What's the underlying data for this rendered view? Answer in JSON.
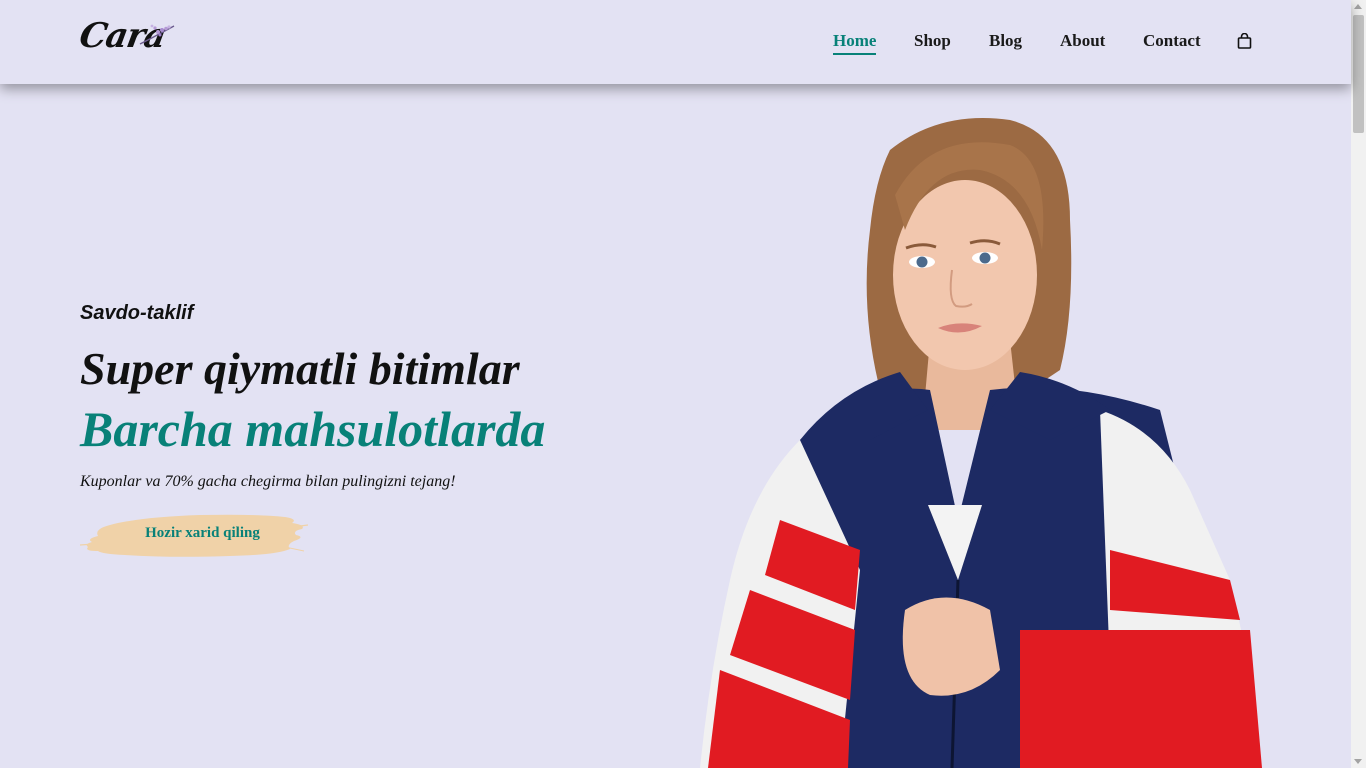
{
  "brand": {
    "logo_text": "Cara"
  },
  "nav": {
    "items": [
      {
        "label": "Home",
        "active": true
      },
      {
        "label": "Shop",
        "active": false
      },
      {
        "label": "Blog",
        "active": false
      },
      {
        "label": "About",
        "active": false
      },
      {
        "label": "Contact",
        "active": false
      }
    ],
    "cart_icon": "shopping-bag-icon"
  },
  "hero": {
    "subtitle": "Savdo-taklif",
    "title": "Super qiymatli bitimlar",
    "highlight": "Barcha mahsulotlarda",
    "description": "Kuponlar va 70% gacha chegirma bilan pulingizni tejang!",
    "button_label": "Hozir xarid qiling",
    "hero_image": "model-in-red-white-navy-windbreaker"
  },
  "colors": {
    "accent": "#088178",
    "background": "#e3e2f3",
    "button_brush": "#f0d2a8",
    "text": "#111111"
  }
}
